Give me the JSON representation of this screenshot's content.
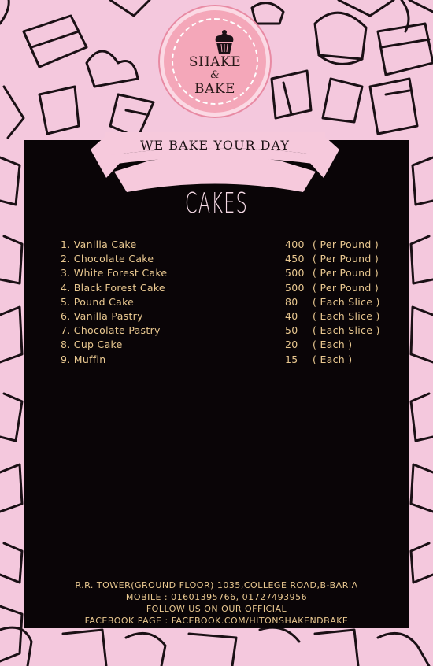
{
  "brand": {
    "line1": "SHAKE",
    "amp": "&",
    "line2": "BAKE"
  },
  "tagline": "WE BAKE YOUR DAY",
  "section_title": "CAKES",
  "menu": [
    {
      "name": "1. Vanilla Cake",
      "price": "400",
      "unit": "( Per Pound )"
    },
    {
      "name": "2. Chocolate Cake",
      "price": "450",
      "unit": "( Per Pound )"
    },
    {
      "name": "3. White Forest Cake",
      "price": "500",
      "unit": "( Per Pound )"
    },
    {
      "name": "4. Black Forest Cake",
      "price": "500",
      "unit": "( Per Pound )"
    },
    {
      "name": "5. Pound Cake",
      "price": "80",
      "unit": "( Each Slice )"
    },
    {
      "name": "6. Vanilla Pastry",
      "price": "40",
      "unit": "( Each Slice )"
    },
    {
      "name": "7. Chocolate Pastry",
      "price": "50",
      "unit": "( Each Slice )"
    },
    {
      "name": "8. Cup Cake",
      "price": "20",
      "unit": "( Each )"
    },
    {
      "name": "9. Muffin",
      "price": "15",
      "unit": "( Each )"
    }
  ],
  "footer": {
    "address": "R.R. TOWER(GROUND FLOOR) 1035,COLLEGE ROAD,B-BARIA",
    "mobile": "MOBILE : 01601395766, 01727493956",
    "follow": "FOLLOW US ON OUR OFFICIAL",
    "facebook": "FACEBOOK PAGE : FACEBOOK.COM/HITONSHAKENDBAKE"
  },
  "colors": {
    "background": "#f4c8dd",
    "panel": "#0a0507",
    "text_gold": "#e9c890",
    "logo_pink": "#f4a7b9",
    "ribbon": "#f6c9dc"
  },
  "icons": [
    "cupcake-icon",
    "cake-doodle-pattern"
  ]
}
